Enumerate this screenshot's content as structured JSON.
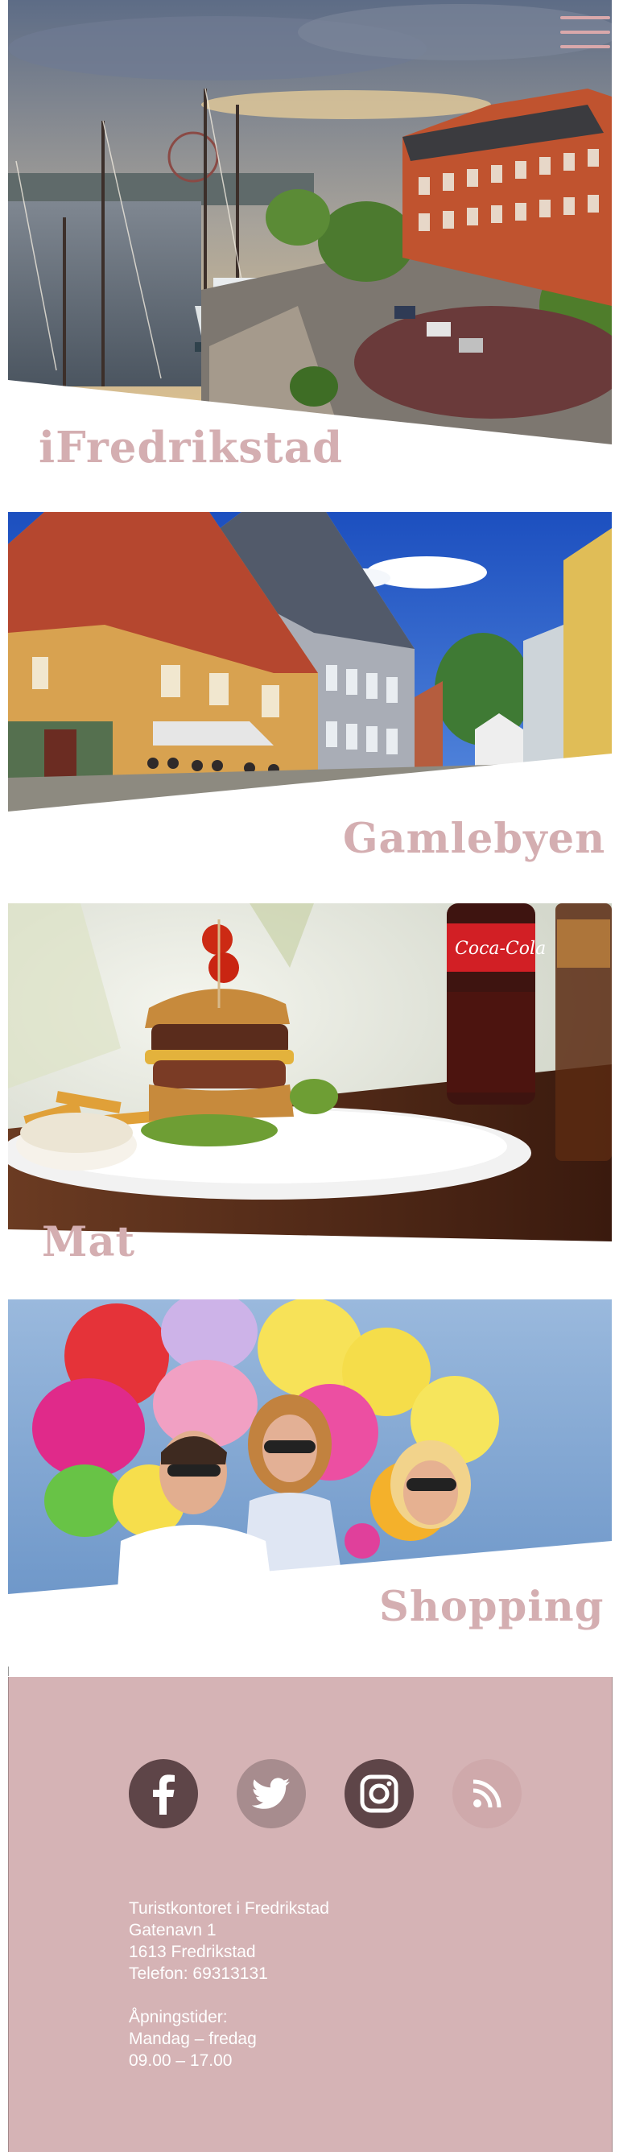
{
  "header": {
    "title": "iFredrikstad",
    "menu_icon": "hamburger-menu-icon"
  },
  "sections": [
    {
      "title": "Gamlebyen"
    },
    {
      "title": "Mat"
    },
    {
      "title": "Shopping"
    }
  ],
  "footer": {
    "social_icons": [
      "facebook-icon",
      "twitter-icon",
      "instagram-icon",
      "rss-icon"
    ],
    "address": {
      "name": "Turistkontoret i Fredrikstad",
      "street": "Gatenavn 1",
      "postal": "1613 Fredrikstad",
      "phone": "Telefon: 69313131"
    },
    "hours": {
      "label": "Åpningstider:",
      "days": "Mandag – fredag",
      "time": "09.00 – 17.00"
    }
  },
  "colors": {
    "accent": "#d4aeb1",
    "footer_bg": "#d5b3b5",
    "social_dark": "#5e4548",
    "social_mid": "#a78c8e"
  }
}
